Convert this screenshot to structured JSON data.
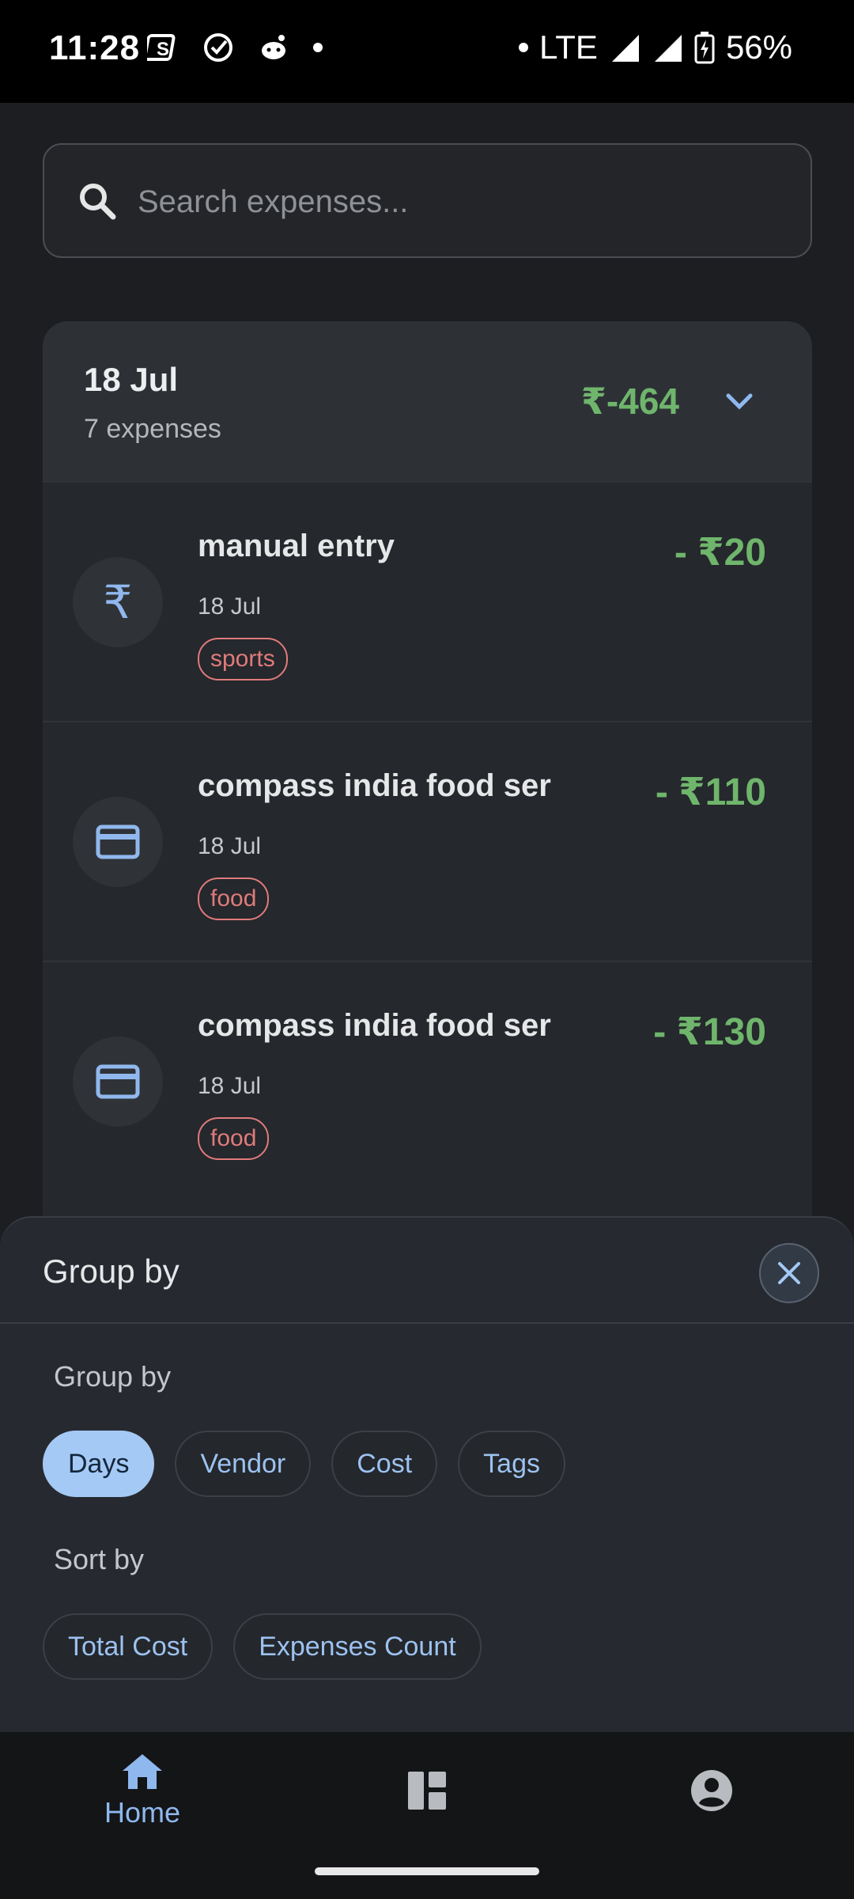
{
  "status_bar": {
    "time": "11:28",
    "network": "LTE",
    "battery": "56%"
  },
  "search": {
    "placeholder": "Search expenses..."
  },
  "group": {
    "date": "18 Jul",
    "count": "7 expenses",
    "total": "₹-464"
  },
  "expenses": [
    {
      "title": "manual entry",
      "date": "18 Jul",
      "tag": "sports",
      "amount": "- ₹20",
      "icon": "rupee-icon"
    },
    {
      "title": "compass india food ser",
      "date": "18 Jul",
      "tag": "food",
      "amount": "- ₹110",
      "icon": "credit-card-icon"
    },
    {
      "title": "compass india food ser",
      "date": "18 Jul",
      "tag": "food",
      "amount": "- ₹130",
      "icon": "credit-card-icon"
    }
  ],
  "sheet": {
    "title": "Group by",
    "group_label": "Group by",
    "group_options": [
      "Days",
      "Vendor",
      "Cost",
      "Tags"
    ],
    "group_selected": "Days",
    "sort_label": "Sort by",
    "sort_options": [
      "Total Cost",
      "Expenses Count"
    ]
  },
  "nav": {
    "home_label": "Home"
  },
  "colors": {
    "accent": "#a4c9f4",
    "amount_green": "#6fb56c",
    "tag_red": "#e07b7b"
  }
}
